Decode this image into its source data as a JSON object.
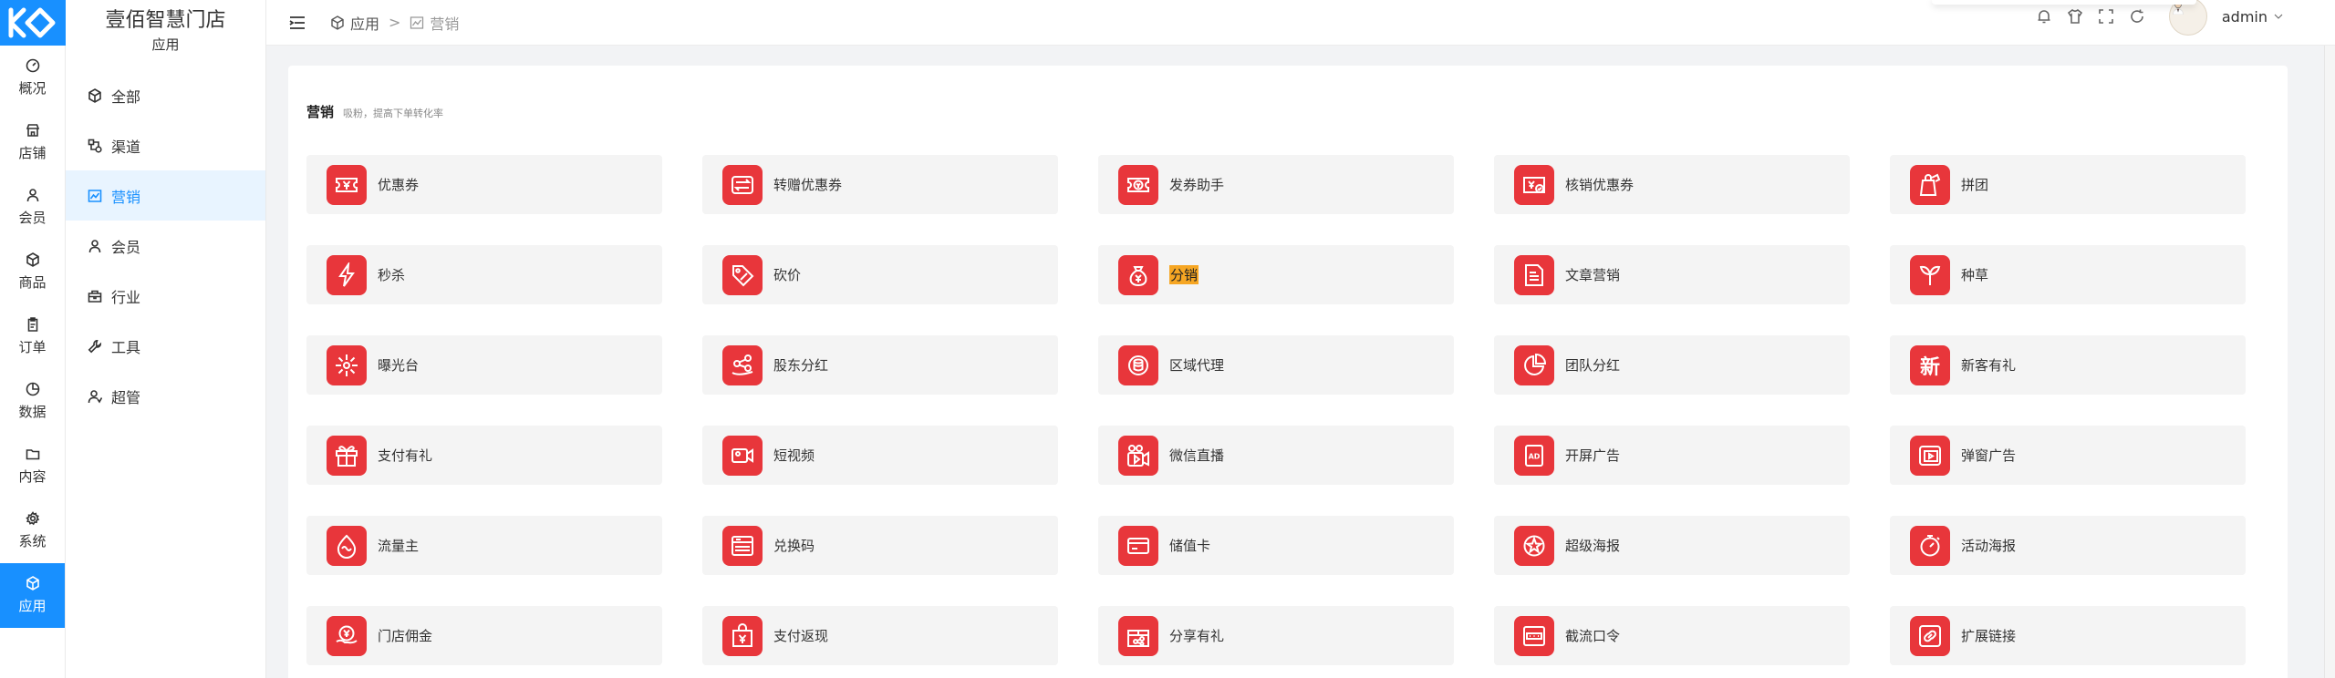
{
  "rail": {
    "items": [
      {
        "label": "概况",
        "icon": "dashboard-icon"
      },
      {
        "label": "店铺",
        "icon": "store-icon"
      },
      {
        "label": "会员",
        "icon": "member-icon"
      },
      {
        "label": "商品",
        "icon": "product-icon"
      },
      {
        "label": "订单",
        "icon": "order-icon"
      },
      {
        "label": "数据",
        "icon": "data-icon"
      },
      {
        "label": "内容",
        "icon": "folder-icon"
      },
      {
        "label": "系统",
        "icon": "gear-icon"
      },
      {
        "label": "应用",
        "icon": "app-cube-icon",
        "active": true
      }
    ]
  },
  "submenu": {
    "store_name": "壹佰智慧门店",
    "section": "应用",
    "items": [
      {
        "label": "全部",
        "icon": "cube-icon"
      },
      {
        "label": "渠道",
        "icon": "channel-icon"
      },
      {
        "label": "营销",
        "icon": "marketing-chart-icon",
        "active": true
      },
      {
        "label": "会员",
        "icon": "user-icon"
      },
      {
        "label": "行业",
        "icon": "industry-icon"
      },
      {
        "label": "工具",
        "icon": "wrench-icon"
      },
      {
        "label": "超管",
        "icon": "admin-icon"
      }
    ]
  },
  "header": {
    "breadcrumb": [
      "应用",
      "营销"
    ],
    "breadcrumb_sep": ">",
    "user": "admin"
  },
  "section": {
    "title": "营销",
    "desc": "吸粉，提高下单转化率"
  },
  "cards": [
    {
      "label": "优惠券",
      "icon": "coupon-icon"
    },
    {
      "label": "转赠优惠券",
      "icon": "transfer-icon"
    },
    {
      "label": "发券助手",
      "icon": "coupon-helper-icon"
    },
    {
      "label": "核销优惠券",
      "icon": "verify-coupon-icon"
    },
    {
      "label": "拼团",
      "icon": "group-buy-icon"
    },
    {
      "label": "秒杀",
      "icon": "flash-icon"
    },
    {
      "label": "砍价",
      "icon": "bargain-tag-icon"
    },
    {
      "label": "分销",
      "icon": "money-bag-icon",
      "highlighted": true
    },
    {
      "label": "文章营销",
      "icon": "article-icon"
    },
    {
      "label": "种草",
      "icon": "sprout-icon"
    },
    {
      "label": "曝光台",
      "icon": "burst-icon"
    },
    {
      "label": "股东分红",
      "icon": "share-dividend-icon"
    },
    {
      "label": "区域代理",
      "icon": "coin-stack-icon"
    },
    {
      "label": "团队分红",
      "icon": "pie-chart-icon"
    },
    {
      "label": "新客有礼",
      "icon": "new-glyph-icon",
      "glyph": "新"
    },
    {
      "label": "支付有礼",
      "icon": "gift-icon"
    },
    {
      "label": "短视频",
      "icon": "video-camera-icon"
    },
    {
      "label": "微信直播",
      "icon": "live-stream-icon"
    },
    {
      "label": "开屏广告",
      "icon": "ad-screen-icon",
      "glyph": "AD"
    },
    {
      "label": "弹窗广告",
      "icon": "popup-ad-icon"
    },
    {
      "label": "流量主",
      "icon": "flow-drop-icon"
    },
    {
      "label": "兑换码",
      "icon": "redeem-code-icon"
    },
    {
      "label": "储值卡",
      "icon": "stored-card-icon"
    },
    {
      "label": "超级海报",
      "icon": "poster-star-icon"
    },
    {
      "label": "活动海报",
      "icon": "timer-icon"
    },
    {
      "label": "门店佣金",
      "icon": "yen-hand-icon"
    },
    {
      "label": "支付返现",
      "icon": "cashback-bag-icon"
    },
    {
      "label": "分享有礼",
      "icon": "share-gift-icon"
    },
    {
      "label": "截流口令",
      "icon": "password-box-icon"
    },
    {
      "label": "扩展链接",
      "icon": "link-icon"
    }
  ],
  "colors": {
    "accent": "#1890ff",
    "icon_bg": "#e8363b",
    "highlight": "#f6a623"
  }
}
